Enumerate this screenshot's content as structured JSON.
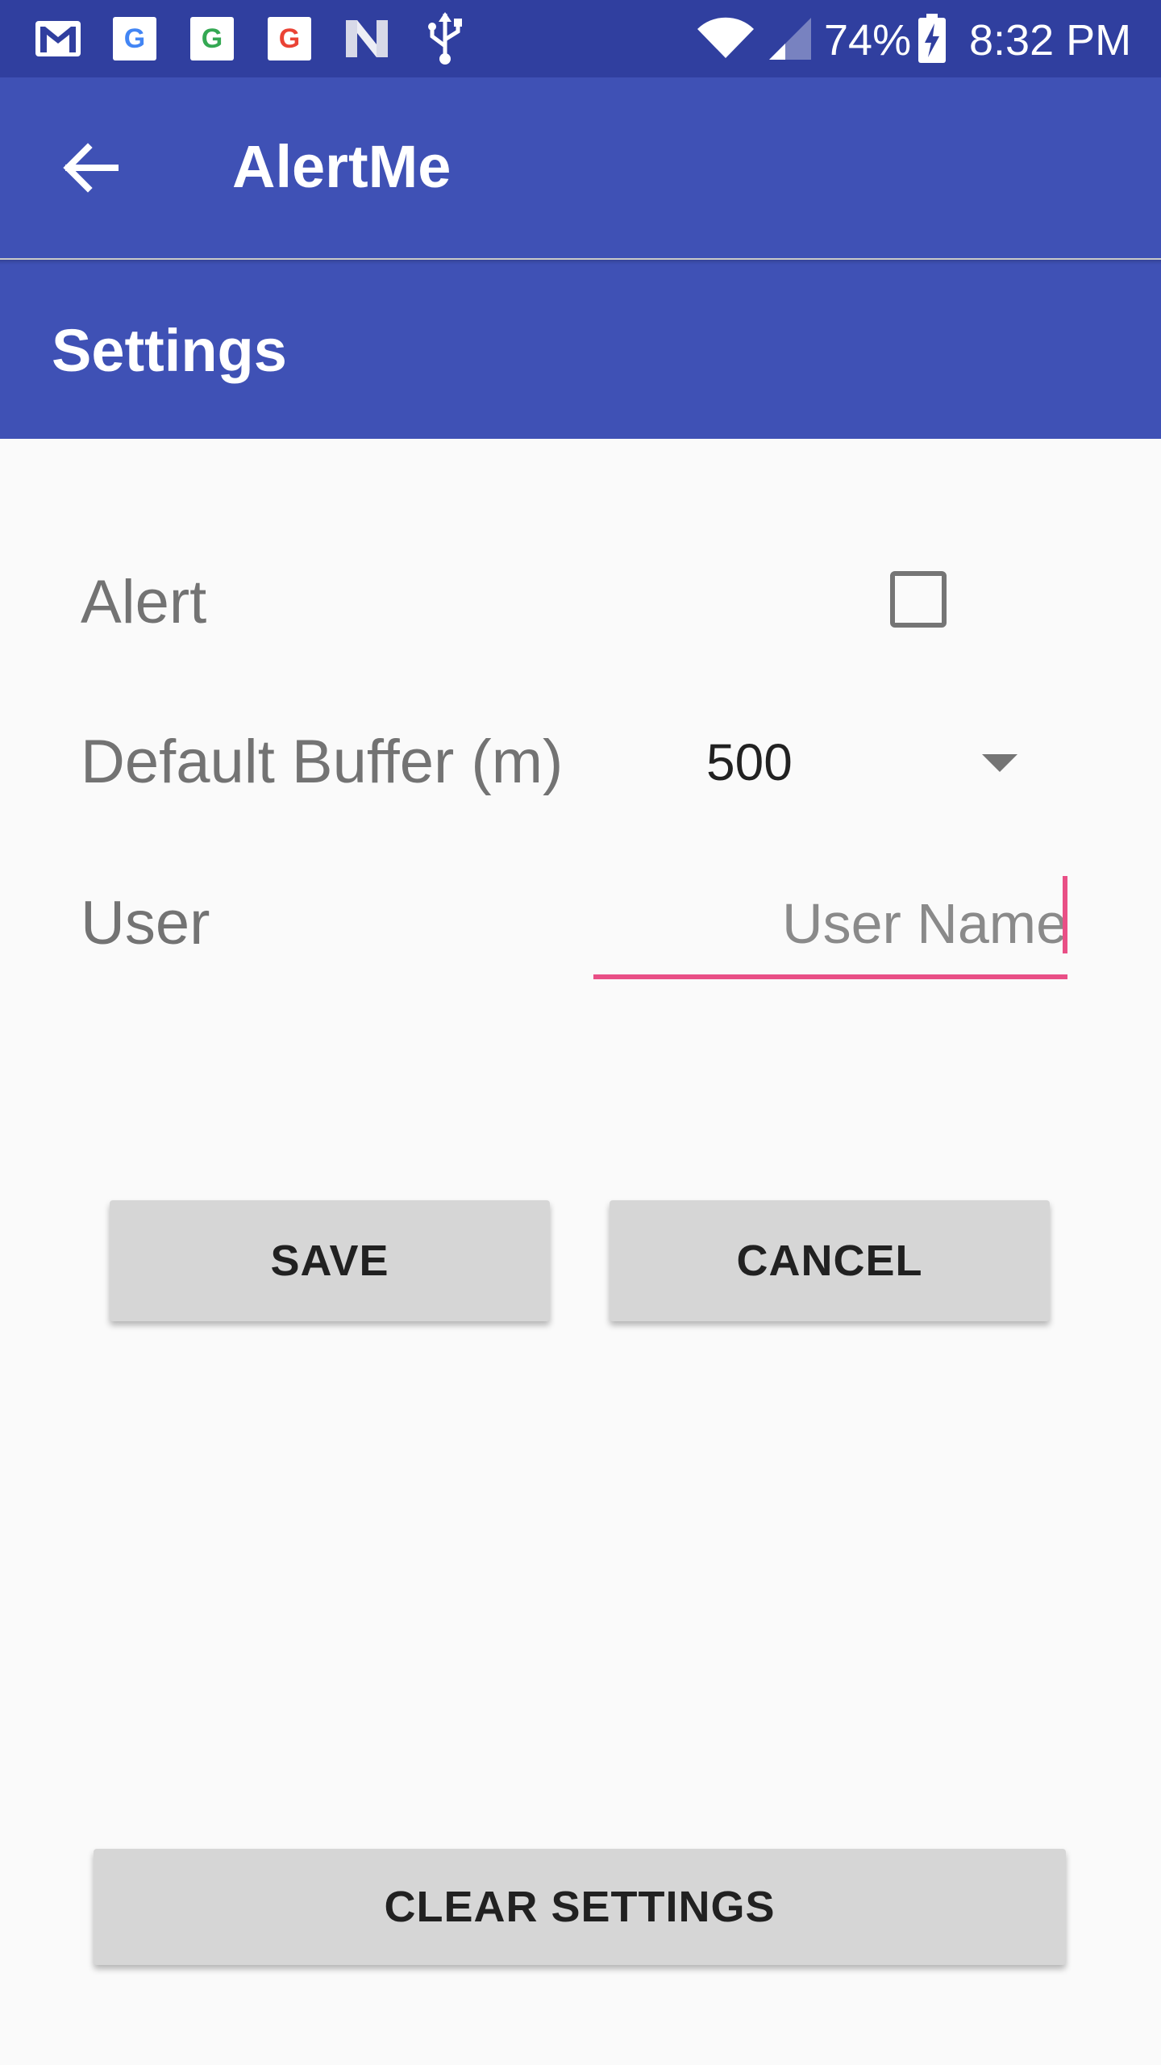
{
  "status_bar": {
    "notification_icons": [
      "gmail-icon",
      "google-icon",
      "google-icon",
      "google-icon",
      "n-icon",
      "usb-icon"
    ],
    "google_badge_letter": "G",
    "battery_percent": "74%",
    "time": "8:32 PM"
  },
  "app_bar": {
    "title": "AlertMe",
    "back_icon": "arrow-left-icon"
  },
  "section": {
    "title": "Settings"
  },
  "form": {
    "alert_label": "Alert",
    "alert_checked": false,
    "buffer_label": "Default Buffer (m)",
    "buffer_value": "500",
    "user_label": "User",
    "user_value": "",
    "user_placeholder": "User Name"
  },
  "buttons": {
    "save": "SAVE",
    "cancel": "CANCEL",
    "clear": "CLEAR SETTINGS"
  },
  "colors": {
    "status_bar": "#303f9f",
    "app_bar": "#3f51b5",
    "accent": "#e94f86",
    "button": "#d6d6d6"
  }
}
